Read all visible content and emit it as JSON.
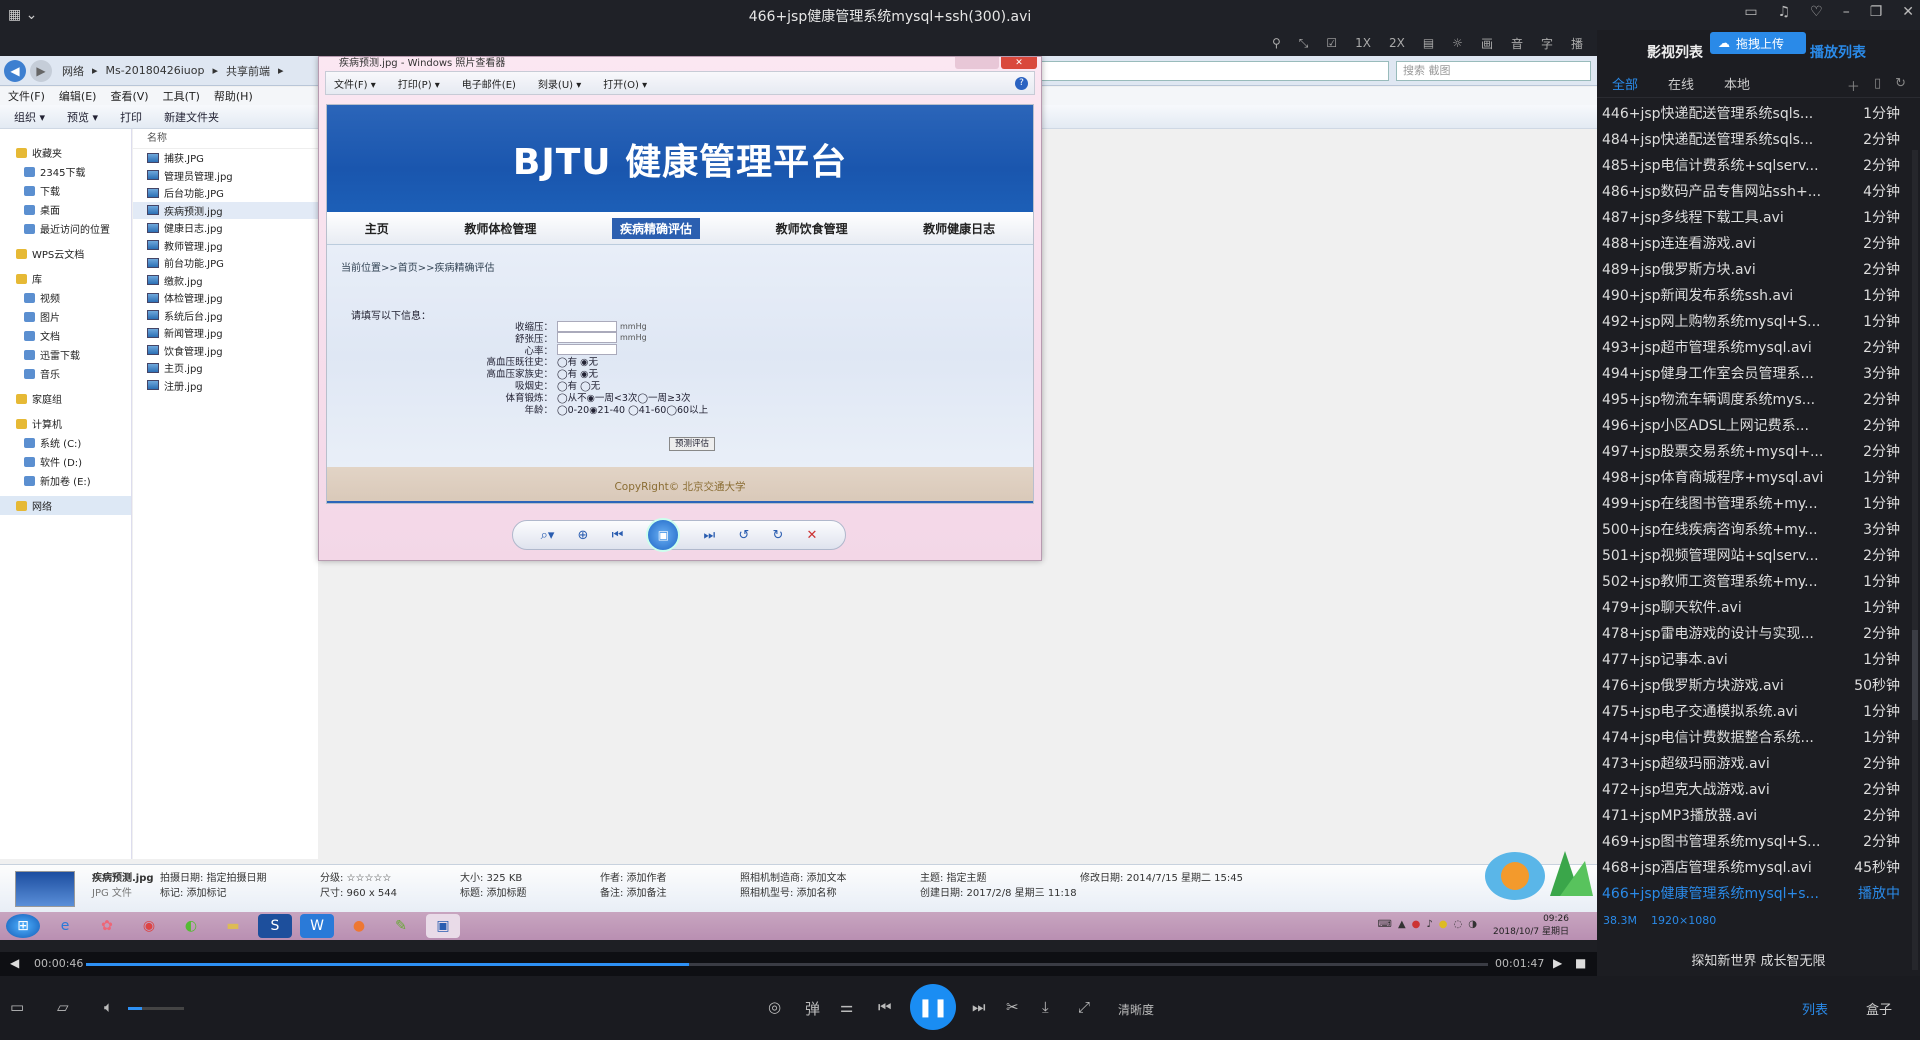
{
  "window": {
    "title": "466+jsp健康管理系统mysql+ssh(300).avi"
  },
  "top_toolbar": [
    "1X",
    "2X",
    "画",
    "音",
    "字",
    "播"
  ],
  "explorer": {
    "breadcrumb": [
      "网络",
      "Ms-20180426iuop",
      "共享前端"
    ],
    "search_placeholder": "搜索 截图",
    "menu": [
      "文件(F)",
      "编辑(E)",
      "查看(V)",
      "工具(T)",
      "帮助(H)"
    ],
    "commands": [
      "组织 ▾",
      "预览 ▾",
      "打印",
      "新建文件夹"
    ],
    "sidebar": [
      {
        "label": "收藏夹",
        "top": true
      },
      {
        "label": "2345下载"
      },
      {
        "label": "下载"
      },
      {
        "label": "桌面"
      },
      {
        "label": "最近访问的位置"
      },
      {
        "label": "WPS云文档",
        "top": true
      },
      {
        "label": "库",
        "top": true
      },
      {
        "label": "视频"
      },
      {
        "label": "图片"
      },
      {
        "label": "文档"
      },
      {
        "label": "迅雷下载"
      },
      {
        "label": "音乐"
      },
      {
        "label": "家庭组",
        "top": true
      },
      {
        "label": "计算机",
        "top": true
      },
      {
        "label": "系统 (C:)"
      },
      {
        "label": "软件 (D:)"
      },
      {
        "label": "新加卷 (E:)"
      },
      {
        "label": "网络",
        "top": true,
        "sel": true
      }
    ],
    "files_header": "名称",
    "files": [
      "捕获.JPG",
      "管理员管理.jpg",
      "后台功能.JPG",
      "疾病预测.jpg",
      "健康日志.jpg",
      "教师管理.jpg",
      "前台功能.JPG",
      "缴款.jpg",
      "体检管理.jpg",
      "系统后台.jpg",
      "新闻管理.jpg",
      "饮食管理.jpg",
      "主页.jpg",
      "注册.jpg"
    ],
    "selected_file": "疾病预测.jpg",
    "status": {
      "name": "疾病预测.jpg",
      "type": "JPG 文件",
      "shot_date": "拍摄日期: 指定拍摄日期",
      "tags": "标记: 添加标记",
      "rating": "分级: ☆☆☆☆☆",
      "size": "尺寸: 960 x 544",
      "filesize": "大小: 325 KB",
      "title": "标题: 添加标题",
      "author": "作者: 添加作者",
      "comment": "备注: 添加备注",
      "maker": "照相机制造商: 添加文本",
      "model": "照相机型号: 添加名称",
      "subject": "主题: 指定主题",
      "created": "创建日期: 2017/2/8 星期三 11:18",
      "modified": "修改日期: 2014/7/15 星期二 15:45"
    }
  },
  "viewer": {
    "title": "疾病预测.jpg - Windows 照片查看器",
    "menu": [
      "文件(F) ▾",
      "打印(P) ▾",
      "电子邮件(E)",
      "刻录(U) ▾",
      "打开(O) ▾"
    ],
    "image": {
      "banner": "BJTU 健康管理平台",
      "nav": [
        "主页",
        "教师体检管理",
        "疾病精确评估",
        "教师饮食管理",
        "教师健康日志"
      ],
      "active_nav": "疾病精确评估",
      "breadcrumb": "当前位置>>首页>>疾病精确评估",
      "hint": "请填写以下信息：",
      "fields": [
        {
          "label": "收缩压：",
          "unit": "mmHg",
          "input": true
        },
        {
          "label": "舒张压：",
          "unit": "mmHg",
          "input": true
        },
        {
          "label": "心率：",
          "unit": "",
          "input": true
        },
        {
          "label": "高血压既往史：",
          "options": "◯有 ◉无"
        },
        {
          "label": "高血压家族史：",
          "options": "◯有 ◉无"
        },
        {
          "label": "吸烟史：",
          "options": "◯有 ◯无"
        },
        {
          "label": "体育锻炼：",
          "options": "◯从不◉一周<3次◯一周≥3次"
        },
        {
          "label": "年龄：",
          "options": "◯0-20◉21-40 ◯41-60◯60以上"
        }
      ],
      "button": "预测评估",
      "copyright": "CopyRight© 北京交通大学"
    }
  },
  "taskbar": {
    "time": "09:26",
    "date": "2018/10/7 星期日"
  },
  "player": {
    "elapsed": "00:00:46",
    "total": "00:01:47",
    "progress": 0.43,
    "quality": "清晰度"
  },
  "playlist": {
    "title": "影视列表",
    "upload": "拖拽上传",
    "tab_label": "播放列表",
    "tabs": [
      "全部",
      "在线",
      "本地"
    ],
    "items": [
      {
        "name": "446+jsp快递配送管理系统sqls...",
        "dur": "1分钟"
      },
      {
        "name": "484+jsp快递配送管理系统sqls...",
        "dur": "2分钟"
      },
      {
        "name": "485+jsp电信计费系统+sqlserv...",
        "dur": "2分钟"
      },
      {
        "name": "486+jsp数码产品专售网站ssh+...",
        "dur": "4分钟"
      },
      {
        "name": "487+jsp多线程下载工具.avi",
        "dur": "1分钟"
      },
      {
        "name": "488+jsp连连看游戏.avi",
        "dur": "2分钟"
      },
      {
        "name": "489+jsp俄罗斯方块.avi",
        "dur": "2分钟"
      },
      {
        "name": "490+jsp新闻发布系统ssh.avi",
        "dur": "1分钟"
      },
      {
        "name": "492+jsp网上购物系统mysql+S...",
        "dur": "1分钟"
      },
      {
        "name": "493+jsp超市管理系统mysql.avi",
        "dur": "2分钟"
      },
      {
        "name": "494+jsp健身工作室会员管理系...",
        "dur": "3分钟"
      },
      {
        "name": "495+jsp物流车辆调度系统mys...",
        "dur": "2分钟"
      },
      {
        "name": "496+jsp小区ADSL上网记费系...",
        "dur": "2分钟"
      },
      {
        "name": "497+jsp股票交易系统+mysql+...",
        "dur": "2分钟"
      },
      {
        "name": "498+jsp体育商城程序+mysql.avi",
        "dur": "1分钟"
      },
      {
        "name": "499+jsp在线图书管理系统+my...",
        "dur": "1分钟"
      },
      {
        "name": "500+jsp在线疾病咨询系统+my...",
        "dur": "3分钟"
      },
      {
        "name": "501+jsp视频管理网站+sqlserv...",
        "dur": "2分钟"
      },
      {
        "name": "502+jsp教师工资管理系统+my...",
        "dur": "1分钟"
      },
      {
        "name": "479+jsp聊天软件.avi",
        "dur": "1分钟"
      },
      {
        "name": "478+jsp雷电游戏的设计与实现...",
        "dur": "2分钟"
      },
      {
        "name": "477+jsp记事本.avi",
        "dur": "1分钟"
      },
      {
        "name": "476+jsp俄罗斯方块游戏.avi",
        "dur": "50秒钟"
      },
      {
        "name": "475+jsp电子交通模拟系统.avi",
        "dur": "1分钟"
      },
      {
        "name": "474+jsp电信计费数据整合系统...",
        "dur": "1分钟"
      },
      {
        "name": "473+jsp超级玛丽游戏.avi",
        "dur": "2分钟"
      },
      {
        "name": "472+jsp坦克大战游戏.avi",
        "dur": "2分钟"
      },
      {
        "name": "471+jspMP3播放器.avi",
        "dur": "2分钟"
      },
      {
        "name": "469+jsp图书管理系统mysql+S...",
        "dur": "2分钟"
      },
      {
        "name": "468+jsp酒店管理系统mysql.avi",
        "dur": "45秒钟"
      },
      {
        "name": "466+jsp健康管理系统mysql+s...",
        "dur": "播放中",
        "current": true
      }
    ],
    "info_size": "38.3M",
    "info_res": "1920×1080",
    "banner": "探知新世界 成长智无限",
    "bottom_tabs": [
      "列表",
      "盒子"
    ]
  },
  "colors": {
    "accent": "#2a8ae8",
    "banner": "#1a56ae"
  }
}
